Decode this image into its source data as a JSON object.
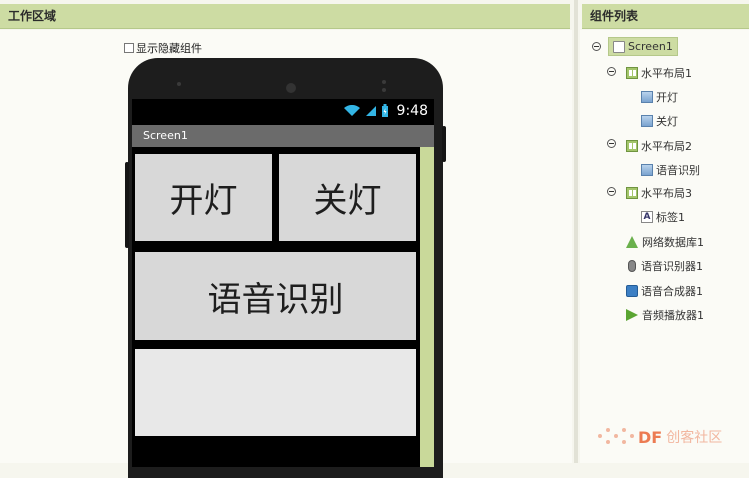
{
  "workspace": {
    "title": "工作区域",
    "show_hidden_label": "显示隐藏组件"
  },
  "components": {
    "title": "组件列表"
  },
  "phone": {
    "status_time": "9:48",
    "screen_title": "Screen1",
    "buttons": {
      "on": "开灯",
      "off": "关灯",
      "voice": "语音识别"
    }
  },
  "tree": {
    "screen1": "Screen1",
    "hlayout1": "水平布局1",
    "btn_on": "开灯",
    "btn_off": "关灯",
    "hlayout2": "水平布局2",
    "btn_voice": "语音识别",
    "hlayout3": "水平布局3",
    "label1": "标签1",
    "webdb1": "网络数据库1",
    "speech_rec1": "语音识别器1",
    "tts1": "语音合成器1",
    "player1": "音频播放器1"
  },
  "watermark": {
    "brand": "DF",
    "sub": "创客社区"
  },
  "colors": {
    "header": "#cddca3",
    "accent": "#a3c56a",
    "watermark": "#ec7b52"
  }
}
